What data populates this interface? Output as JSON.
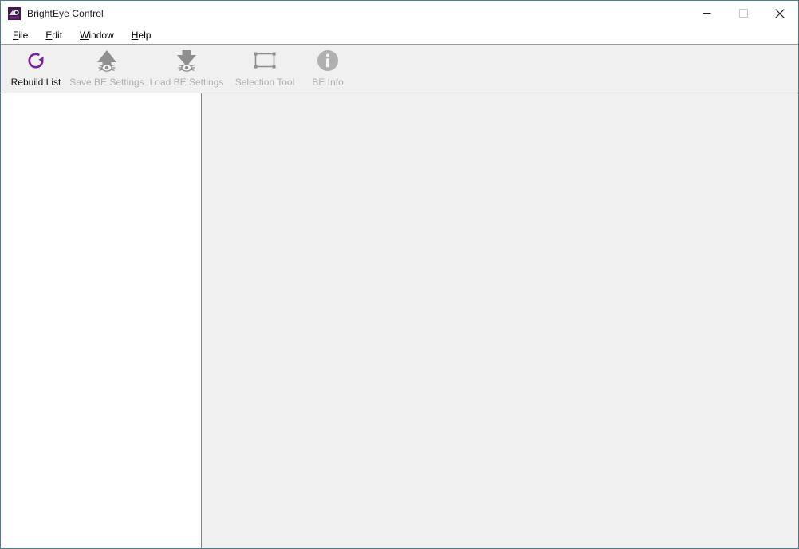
{
  "window": {
    "title": "BrightEye Control",
    "icon": "app-icon",
    "accent_border_color": "#4b7b93",
    "titlebar_background": "#ffffff",
    "controls": [
      {
        "name": "minimize",
        "glyph": "minimize-icon",
        "label": "Minimize"
      },
      {
        "name": "maximize",
        "glyph": "maximize-icon",
        "label": "Maximize"
      },
      {
        "name": "close",
        "glyph": "close-icon",
        "label": "Close"
      }
    ]
  },
  "menu": {
    "items": [
      {
        "mnemonic": "F",
        "rest": "ile"
      },
      {
        "mnemonic": "E",
        "rest": "dit"
      },
      {
        "mnemonic": "W",
        "rest": "indow"
      },
      {
        "mnemonic": "H",
        "rest": "elp"
      }
    ]
  },
  "toolbar": {
    "background": "#f0f0f0",
    "buttons": [
      {
        "label": "Rebuild List",
        "icon": "refresh-circular-arrow-icon",
        "enabled": true,
        "color": "#7b1fa2"
      },
      {
        "label": "Save BE Settings",
        "icon": "up-arrow-eye-icon",
        "enabled": false,
        "color": "#1a1a1a"
      },
      {
        "label": "Load BE Settings",
        "icon": "down-arrow-eye-icon",
        "enabled": false,
        "color": "#1a1a1a"
      },
      {
        "label": "Selection Tool",
        "icon": "selection-rectangle-icon",
        "enabled": false,
        "color": "#1a1a1a"
      },
      {
        "label": "BE Info",
        "icon": "info-circle-icon",
        "enabled": false,
        "color": "#636363"
      }
    ]
  },
  "panes": {
    "left": {
      "name": "device-list-pane",
      "background": "#ffffff",
      "content": ""
    },
    "right": {
      "name": "detail-pane",
      "background": "#f0f0f0",
      "content": ""
    }
  }
}
